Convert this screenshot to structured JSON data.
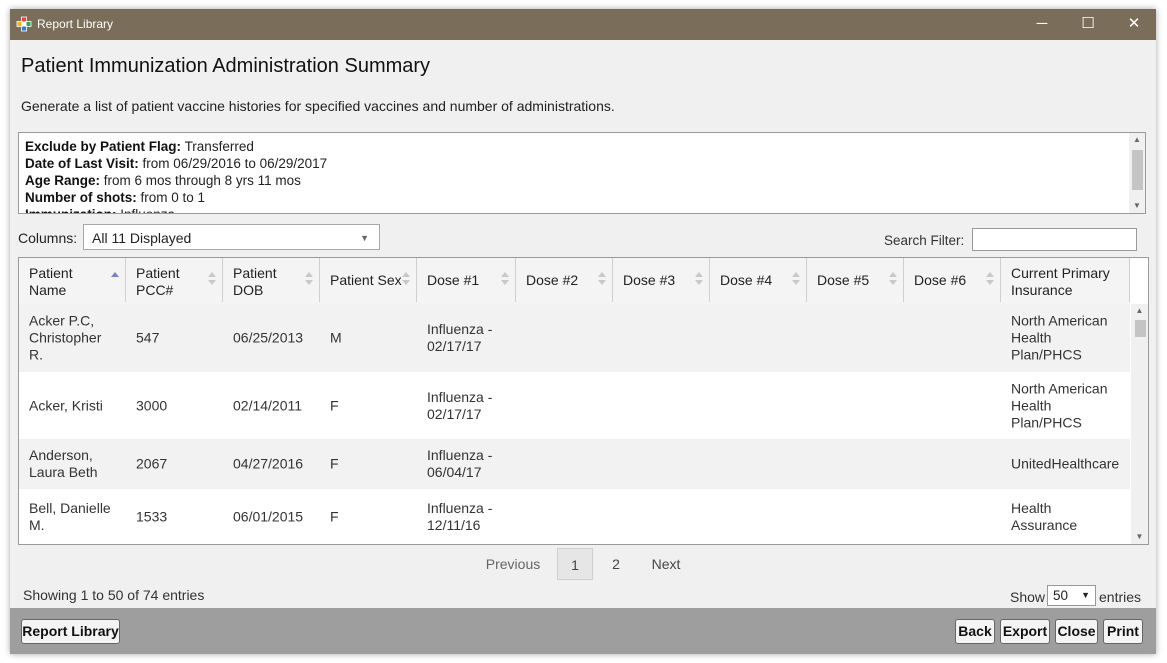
{
  "window": {
    "title": "Report Library",
    "controls": {
      "minimize": "─",
      "maximize": "☐",
      "close": "✕"
    }
  },
  "page": {
    "title": "Patient Immunization Administration Summary",
    "description": "Generate a list of patient vaccine histories for specified vaccines and number of administrations."
  },
  "criteria": [
    {
      "label": "Exclude by Patient Flag:",
      "value": "Transferred"
    },
    {
      "label": "Date of Last Visit:",
      "value": "from 06/29/2016 to 06/29/2017"
    },
    {
      "label": "Age Range:",
      "value": "from 6 mos through 8 yrs 11 mos"
    },
    {
      "label": "Number of shots:",
      "value": "from 0 to 1"
    },
    {
      "label": "Immunization:",
      "value": "Influenza"
    }
  ],
  "columns_control": {
    "label": "Columns:",
    "value": "All 11 Displayed"
  },
  "search": {
    "label": "Search Filter:",
    "placeholder": "",
    "value": ""
  },
  "table": {
    "headers": [
      {
        "lines": [
          "Patient",
          "Name"
        ],
        "sort": "asc"
      },
      {
        "lines": [
          "Patient",
          "PCC#"
        ],
        "sort": "none"
      },
      {
        "lines": [
          "Patient",
          "DOB"
        ],
        "sort": "none"
      },
      {
        "lines": [
          "Patient Sex"
        ],
        "sort": "none"
      },
      {
        "lines": [
          "Dose #1"
        ],
        "sort": "none"
      },
      {
        "lines": [
          "Dose #2"
        ],
        "sort": "none"
      },
      {
        "lines": [
          "Dose #3"
        ],
        "sort": "none"
      },
      {
        "lines": [
          "Dose #4"
        ],
        "sort": "none"
      },
      {
        "lines": [
          "Dose #5"
        ],
        "sort": "none"
      },
      {
        "lines": [
          "Dose #6"
        ],
        "sort": "none"
      },
      {
        "lines": [
          "Current Primary",
          "Insurance"
        ],
        "sort": "none"
      }
    ],
    "rows": [
      [
        [
          "Acker P.C,",
          "Christopher",
          "R."
        ],
        [
          "547"
        ],
        [
          "06/25/2013"
        ],
        [
          "M"
        ],
        [
          "Influenza -",
          "02/17/17"
        ],
        [],
        [],
        [],
        [],
        [],
        [
          "North American",
          "Health",
          "Plan/PHCS"
        ]
      ],
      [
        [
          "Acker, Kristi"
        ],
        [
          "3000"
        ],
        [
          "02/14/2011"
        ],
        [
          "F"
        ],
        [
          "Influenza -",
          "02/17/17"
        ],
        [],
        [],
        [],
        [],
        [],
        [
          "North American",
          "Health",
          "Plan/PHCS"
        ]
      ],
      [
        [
          "Anderson,",
          "Laura Beth"
        ],
        [
          "2067"
        ],
        [
          "04/27/2016"
        ],
        [
          "F"
        ],
        [
          "Influenza -",
          "06/04/17"
        ],
        [],
        [],
        [],
        [],
        [],
        [
          "UnitedHealthcare"
        ]
      ],
      [
        [
          "Bell, Danielle",
          "M."
        ],
        [
          "1533"
        ],
        [
          "06/01/2015"
        ],
        [
          "F"
        ],
        [
          "Influenza -",
          "12/11/16"
        ],
        [],
        [],
        [],
        [],
        [],
        [
          "Health",
          "Assurance"
        ]
      ]
    ]
  },
  "pagination": {
    "previous": "Previous",
    "pages": [
      "1",
      "2"
    ],
    "current": "1",
    "next": "Next"
  },
  "info": "Showing 1 to 50 of 74 entries",
  "page_size": {
    "label": "Show",
    "value": "50",
    "suffix": "entries"
  },
  "footer": {
    "report_library": "Report Library",
    "back": "Back",
    "export": "Export",
    "close": "Close",
    "print": "Print"
  },
  "colors": {
    "titlebar": "#7a6d5a",
    "footer": "#9e9e9e",
    "sort_active": "#7b7fc8"
  },
  "icons": {
    "app": "colorful-cross-icon"
  }
}
